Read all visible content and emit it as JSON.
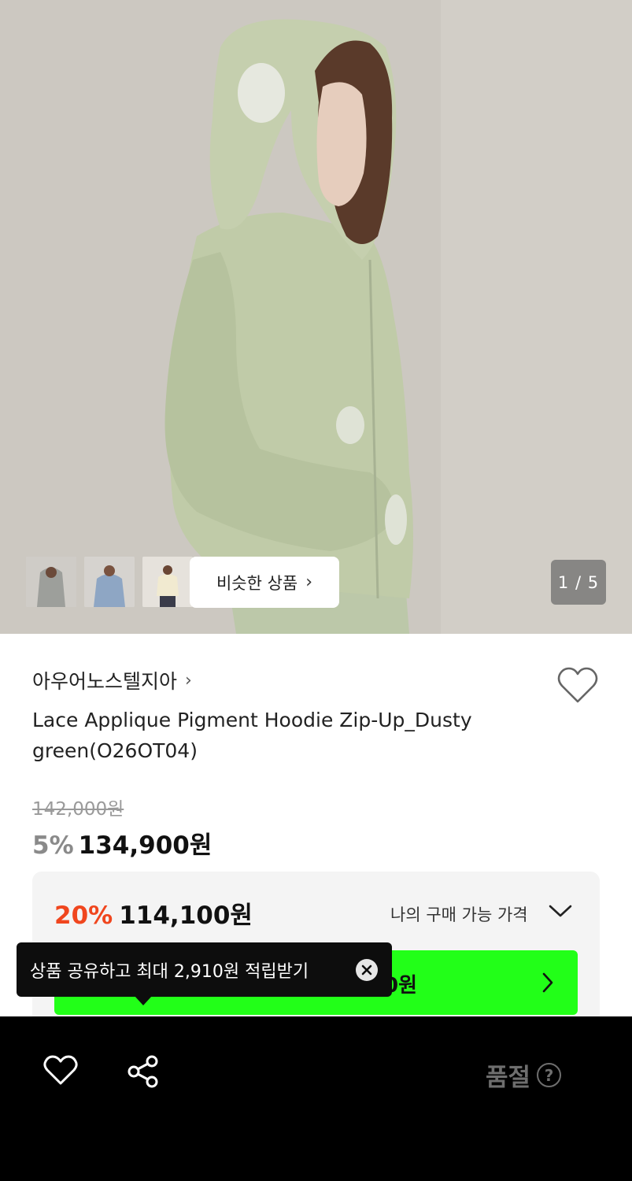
{
  "gallery": {
    "similar_label": "비슷한 상품",
    "similar_chevron": "›",
    "current_page": "1",
    "total_pages": "5",
    "page_text": "1 / 5",
    "thumbnail_count": 3
  },
  "product": {
    "brand": "아우어노스텔지아",
    "brand_chevron": "›",
    "title": "Lace Applique Pigment Hoodie Zip-Up_Dusty green(O26OT04)",
    "original_price": "142,000원",
    "discount_rate": "5%",
    "sale_price": "134,900원"
  },
  "my_price": {
    "discount_rate": "20%",
    "price": "114,100원",
    "label": "나의 구매 가능 가격"
  },
  "coupon_bar": {
    "visible_text": "0원"
  },
  "tooltip": {
    "text": "상품 공유하고 최대 2,910원 적립받기"
  },
  "bottom_bar": {
    "status": "품절",
    "help": "?"
  },
  "colors": {
    "accent_red": "#f0461e",
    "coupon_green": "#22ff18",
    "bottom_bar_bg": "#000000"
  }
}
